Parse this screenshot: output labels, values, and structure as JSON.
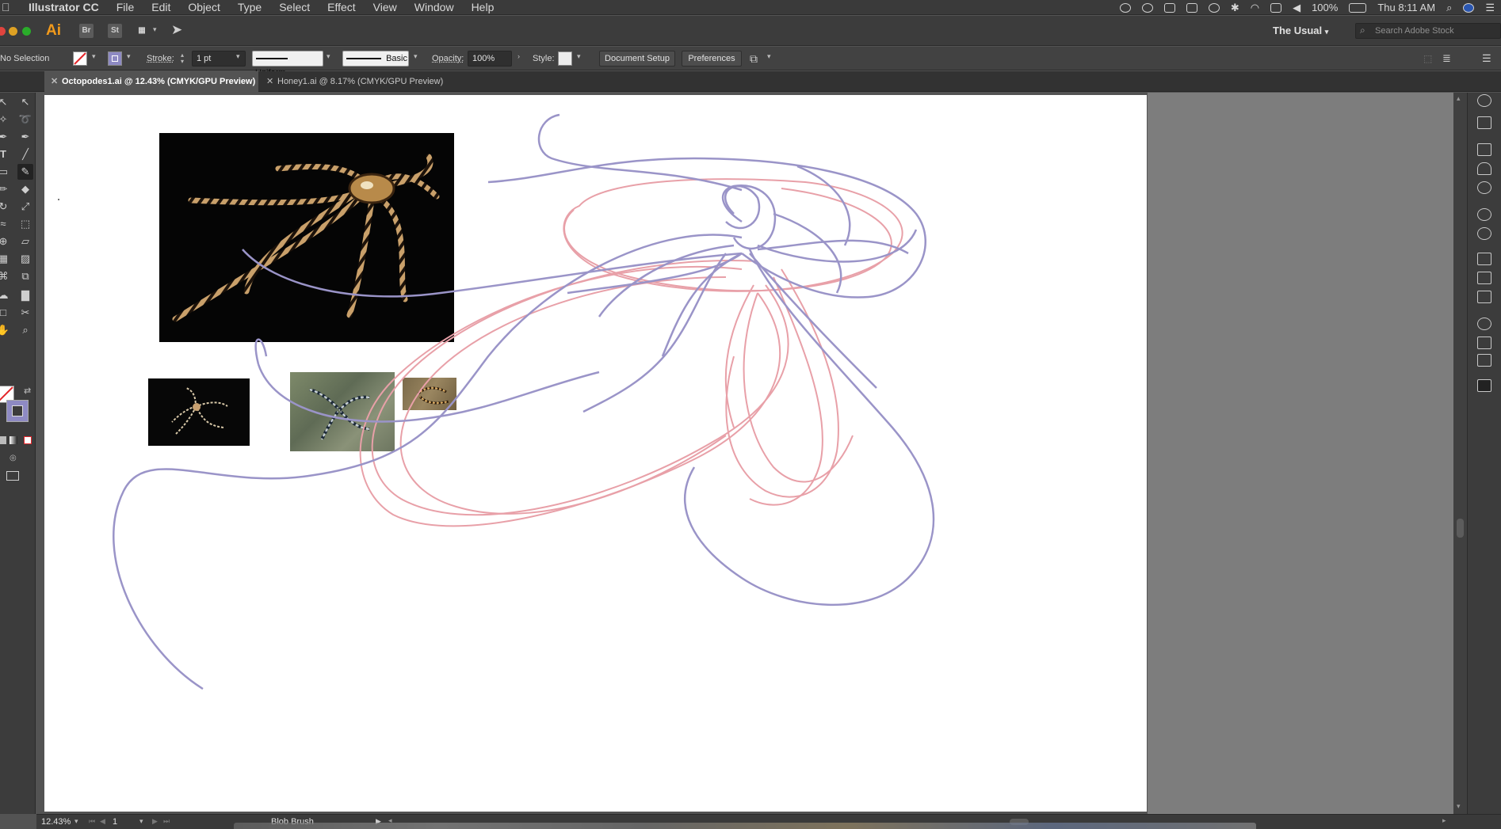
{
  "menubar": {
    "app_name": "Illustrator CC",
    "items": [
      "File",
      "Edit",
      "Object",
      "Type",
      "Select",
      "Effect",
      "View",
      "Window",
      "Help"
    ],
    "battery": "100%",
    "clock": "Thu 8:11 AM"
  },
  "appbar": {
    "logo": "Ai",
    "bridge": "Br",
    "stock": "St",
    "workspace": "The Usual",
    "search_placeholder": "Search Adobe Stock"
  },
  "controlbar": {
    "selection": "No Selection",
    "stroke_label": "Stroke:",
    "stroke_value": "1 pt",
    "profile": "Uniform",
    "brush": "Basic",
    "opacity_label": "Opacity:",
    "opacity_value": "100%",
    "style_label": "Style:",
    "document_setup": "Document Setup",
    "preferences": "Preferences"
  },
  "tabs": [
    {
      "label": "Octopodes1.ai @ 12.43% (CMYK/GPU Preview)",
      "active": true
    },
    {
      "label": "Honey1.ai @ 8.17% (CMYK/GPU Preview)",
      "active": false
    }
  ],
  "statusbar": {
    "zoom": "12.43%",
    "artboard": "1",
    "tool": "Blob Brush"
  },
  "colors": {
    "stroke_purple": "#9a94c8",
    "stroke_pink": "#e8a0a8",
    "accent_orange": "#f29a1b"
  },
  "icons": {
    "toolbar": [
      "selection-icon",
      "direct-selection-icon",
      "magic-wand-icon",
      "lasso-icon",
      "pen-icon",
      "curvature-icon",
      "type-icon",
      "line-icon",
      "rectangle-icon",
      "paintbrush-icon",
      "pencil-icon",
      "eraser-icon",
      "rotate-icon",
      "scale-icon",
      "warp-icon",
      "free-transform-icon",
      "shape-builder-icon",
      "perspective-icon",
      "mesh-icon",
      "gradient-icon",
      "eyedropper-icon",
      "blend-icon",
      "symbol-sprayer-icon",
      "graph-icon",
      "artboard-icon",
      "slice-icon",
      "hand-icon",
      "zoom-icon"
    ],
    "panels": [
      "libraries-icon",
      "properties-icon",
      "swatches-icon",
      "brushes-icon",
      "symbols-icon",
      "appearance-icon",
      "cc-libraries-icon",
      "transform-icon",
      "align-icon",
      "pathfinder-icon",
      "color-icon",
      "gradient-panel-icon",
      "stroke-panel-icon",
      "layers-icon"
    ]
  }
}
